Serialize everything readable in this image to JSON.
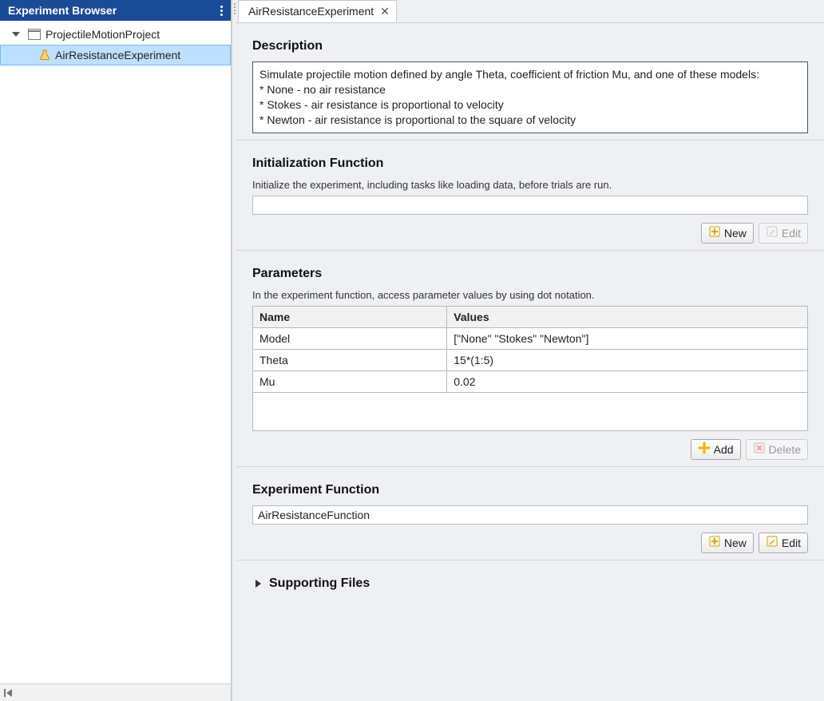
{
  "sidebar": {
    "title": "Experiment Browser",
    "project": "ProjectileMotionProject",
    "experiment": "AirResistanceExperiment"
  },
  "tab": {
    "label": "AirResistanceExperiment"
  },
  "description": {
    "heading": "Description",
    "text": "Simulate projectile motion defined by angle Theta, coefficient of friction Mu, and one of these models:\n* None - no air resistance\n* Stokes - air resistance is proportional to velocity\n* Newton - air resistance is proportional to the square of velocity"
  },
  "initfn": {
    "heading": "Initialization Function",
    "help": "Initialize the experiment, including tasks like loading data, before trials are run.",
    "value": "",
    "buttons": {
      "new": "New",
      "edit": "Edit"
    }
  },
  "parameters": {
    "heading": "Parameters",
    "help": "In the experiment function, access parameter values by using dot notation.",
    "columns": {
      "name": "Name",
      "values": "Values"
    },
    "rows": [
      {
        "name": "Model",
        "values": "[\"None\" \"Stokes\" \"Newton\"]"
      },
      {
        "name": "Theta",
        "values": "15*(1:5)"
      },
      {
        "name": "Mu",
        "values": "0.02"
      }
    ],
    "buttons": {
      "add": "Add",
      "delete": "Delete"
    }
  },
  "expfn": {
    "heading": "Experiment Function",
    "value": "AirResistanceFunction",
    "buttons": {
      "new": "New",
      "edit": "Edit"
    }
  },
  "supporting": {
    "heading": "Supporting Files"
  }
}
